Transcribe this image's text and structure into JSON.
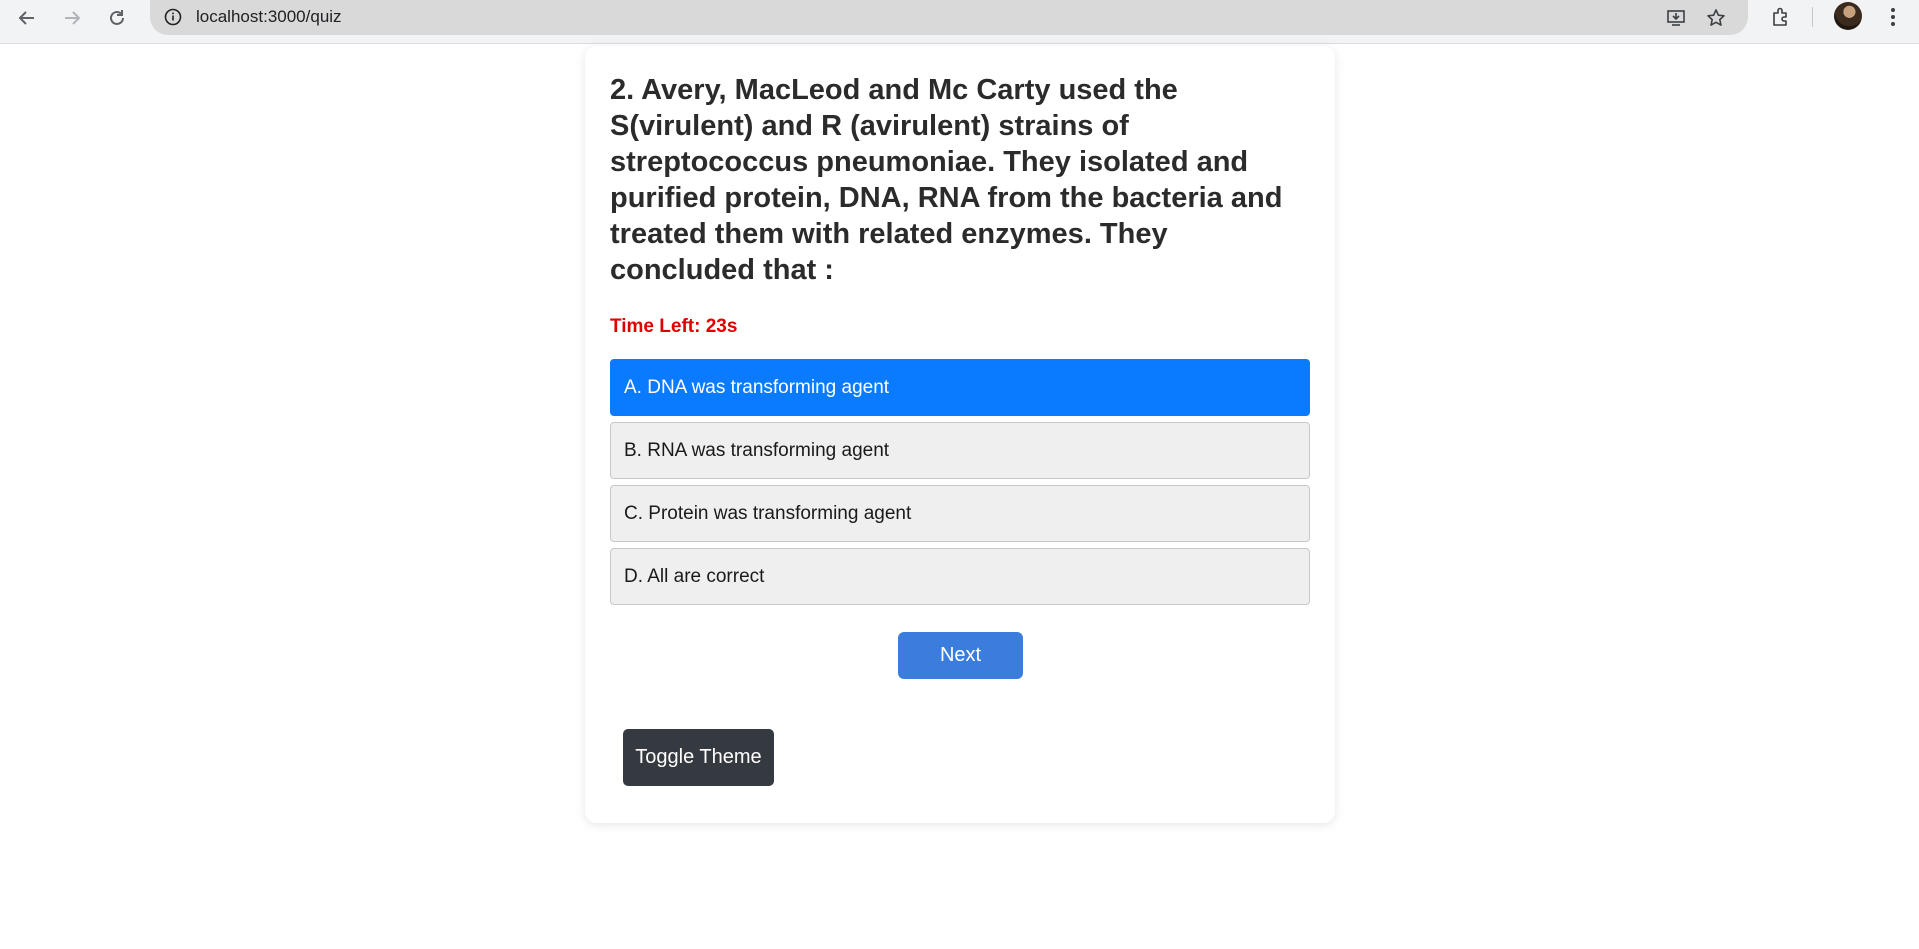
{
  "browser": {
    "url": "localhost:3000/quiz",
    "icons": [
      "back-icon",
      "forward-icon",
      "reload-icon",
      "site-info-icon",
      "install-app-icon",
      "bookmark-star-icon",
      "extensions-icon",
      "profile-avatar",
      "more-menu-icon"
    ]
  },
  "quiz": {
    "question": "2. Avery, MacLeod and Mc Carty used the S(virulent) and R (avirulent) strains of streptococcus pneumoniae. They isolated and purified protein, DNA, RNA from the bacteria and treated them with related enzymes. They concluded that :",
    "timer": "Time Left: 23s",
    "options": [
      {
        "label": "A. DNA was transforming agent",
        "selected": true
      },
      {
        "label": "B. RNA was transforming agent",
        "selected": false
      },
      {
        "label": "C. Protein was transforming agent",
        "selected": false
      },
      {
        "label": "D. All are correct",
        "selected": false
      }
    ],
    "next_label": "Next",
    "toggle_theme_label": "Toggle Theme"
  },
  "colors": {
    "selected_option": "#0a7bff",
    "option_bg": "#efefef",
    "timer": "#e00000",
    "next_button": "#3b7ddd",
    "toggle_button": "#343a40"
  }
}
